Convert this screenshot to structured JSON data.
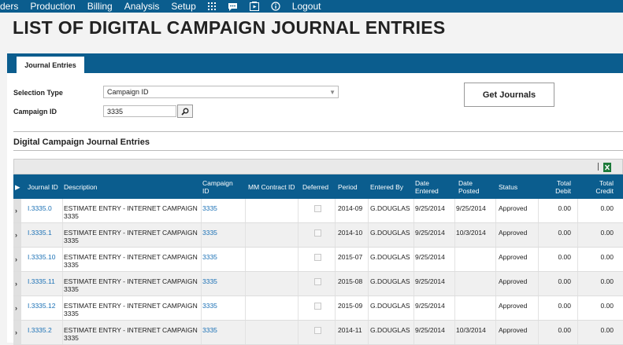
{
  "nav": {
    "items": [
      "rders",
      "Production",
      "Billing",
      "Analysis",
      "Setup"
    ],
    "icons": [
      "grid-icon",
      "chat-icon",
      "video-icon",
      "info-icon"
    ],
    "logout": "Logout"
  },
  "page": {
    "title": "LIST OF DIGITAL CAMPAIGN JOURNAL ENTRIES"
  },
  "tabs": [
    {
      "label": "Journal Entries"
    }
  ],
  "form": {
    "selection_type_label": "Selection Type",
    "selection_type_value": "Campaign ID",
    "campaign_id_label": "Campaign ID",
    "campaign_id_value": "3335",
    "get_journals_label": "Get Journals"
  },
  "section": {
    "title": "Digital Campaign Journal Entries"
  },
  "grid": {
    "columns": [
      "Journal ID",
      "Description",
      "Campaign ID",
      "MM Contract ID",
      "Deferred",
      "Period",
      "Entered By",
      "Date Entered",
      "Date Posted",
      "Status",
      "Total Debit",
      "Total Credit"
    ],
    "rows": [
      {
        "journal_id": "I.3335.0",
        "description": "ESTIMATE ENTRY - INTERNET CAMPAIGN 3335",
        "campaign_id": "3335",
        "mm_contract_id": "",
        "period": "2014-09",
        "entered_by": "G.DOUGLAS",
        "date_entered": "9/25/2014",
        "date_posted": "9/25/2014",
        "status": "Approved",
        "total_debit": "0.00",
        "total_credit": "0.00"
      },
      {
        "journal_id": "I.3335.1",
        "description": "ESTIMATE ENTRY - INTERNET CAMPAIGN 3335",
        "campaign_id": "3335",
        "mm_contract_id": "",
        "period": "2014-10",
        "entered_by": "G.DOUGLAS",
        "date_entered": "9/25/2014",
        "date_posted": "10/3/2014",
        "status": "Approved",
        "total_debit": "0.00",
        "total_credit": "0.00"
      },
      {
        "journal_id": "I.3335.10",
        "description": "ESTIMATE ENTRY - INTERNET CAMPAIGN 3335",
        "campaign_id": "3335",
        "mm_contract_id": "",
        "period": "2015-07",
        "entered_by": "G.DOUGLAS",
        "date_entered": "9/25/2014",
        "date_posted": "",
        "status": "Approved",
        "total_debit": "0.00",
        "total_credit": "0.00"
      },
      {
        "journal_id": "I.3335.11",
        "description": "ESTIMATE ENTRY - INTERNET CAMPAIGN 3335",
        "campaign_id": "3335",
        "mm_contract_id": "",
        "period": "2015-08",
        "entered_by": "G.DOUGLAS",
        "date_entered": "9/25/2014",
        "date_posted": "",
        "status": "Approved",
        "total_debit": "0.00",
        "total_credit": "0.00"
      },
      {
        "journal_id": "I.3335.12",
        "description": "ESTIMATE ENTRY - INTERNET CAMPAIGN 3335",
        "campaign_id": "3335",
        "mm_contract_id": "",
        "period": "2015-09",
        "entered_by": "G.DOUGLAS",
        "date_entered": "9/25/2014",
        "date_posted": "",
        "status": "Approved",
        "total_debit": "0.00",
        "total_credit": "0.00"
      },
      {
        "journal_id": "I.3335.2",
        "description": "ESTIMATE ENTRY - INTERNET CAMPAIGN 3335",
        "campaign_id": "3335",
        "mm_contract_id": "",
        "period": "2014-11",
        "entered_by": "G.DOUGLAS",
        "date_entered": "9/25/2014",
        "date_posted": "10/3/2014",
        "status": "Approved",
        "total_debit": "0.00",
        "total_credit": "0.00"
      }
    ]
  },
  "colors": {
    "brand": "#0b5d8e",
    "link": "#1a70b5",
    "excel": "#1d7a3a"
  }
}
